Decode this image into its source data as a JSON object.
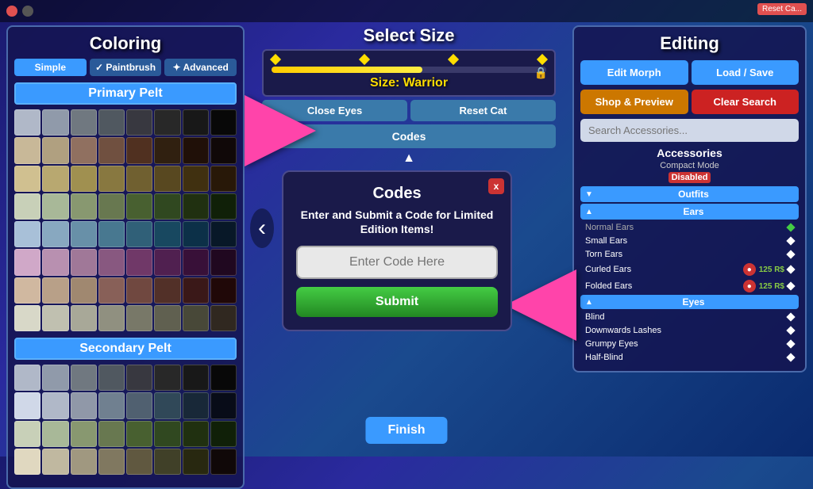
{
  "topbar": {
    "reset_label": "Reset Ca..."
  },
  "left_panel": {
    "title": "Coloring",
    "tabs": [
      {
        "label": "Simple",
        "active": true
      },
      {
        "label": "✓ Paintbrush",
        "active": false
      },
      {
        "label": "✦ Advanced",
        "active": false
      }
    ],
    "primary_label": "Primary Pelt",
    "secondary_label": "Secondary Pelt"
  },
  "center_top": {
    "title": "Select Size",
    "size_label": "Size: Warrior",
    "close_eyes_btn": "Close Eyes",
    "reset_cat_btn": "Reset Cat",
    "codes_btn": "Codes",
    "slider_percent": 55
  },
  "codes_modal": {
    "title": "Codes",
    "subtitle": "Enter and Submit a Code for Limited Edition Items!",
    "input_placeholder": "Enter Code Here",
    "submit_label": "Submit",
    "close_label": "x"
  },
  "right_panel": {
    "title": "Editing",
    "edit_morph_btn": "Edit Morph",
    "load_save_btn": "Load / Save",
    "shop_preview_btn": "Shop & Preview",
    "clear_search_btn": "Clear Search",
    "search_placeholder": "Search Accessories...",
    "accessories_label": "Accessories",
    "compact_mode_label": "Compact Mode",
    "disabled_label": "Disabled",
    "categories": [
      {
        "label": "Outfits",
        "active": true
      },
      {
        "label": "Ears",
        "active": true
      }
    ],
    "ear_items": [
      {
        "label": "Normal Ears",
        "dimmed": true,
        "has_diamond": true,
        "diamond_green": true
      },
      {
        "label": "Small Ears",
        "dimmed": false,
        "has_diamond": true
      },
      {
        "label": "Torn Ears",
        "dimmed": false,
        "has_diamond": true
      },
      {
        "label": "Curled Ears",
        "dimmed": false,
        "has_price": true,
        "price": "125 R$",
        "has_diamond": true
      },
      {
        "label": "Folded Ears",
        "dimmed": false,
        "has_price": true,
        "price": "125 R$",
        "has_diamond": true
      }
    ],
    "eyes_header": "Eyes",
    "eye_items": [
      {
        "label": "Blind",
        "has_diamond": true
      },
      {
        "label": "Downwards Lashes",
        "has_diamond": true
      },
      {
        "label": "Grumpy Eyes",
        "has_diamond": true
      },
      {
        "label": "Half-Blind",
        "has_diamond": true
      }
    ]
  },
  "finish_btn": "Finish",
  "colors": {
    "primary_rows": [
      [
        "#b0b8c8",
        "#909aaa",
        "#707880",
        "#505860",
        "#383840",
        "#282828",
        "#181818",
        "#080808"
      ],
      [
        "#c8b898",
        "#b0a080",
        "#907060",
        "#705040",
        "#503020",
        "#302010",
        "#201008",
        "#100808"
      ],
      [
        "#d0c090",
        "#b8a870",
        "#a09050",
        "#887840",
        "#706030",
        "#584820",
        "#403010",
        "#281808"
      ],
      [
        "#c8d0b8",
        "#a8b898",
        "#889870",
        "#687850",
        "#486030",
        "#304820",
        "#203010",
        "#102008"
      ],
      [
        "#a8c0d8",
        "#88a8c0",
        "#6890a8",
        "#487890",
        "#306078",
        "#184860",
        "#0c3048",
        "#081828"
      ],
      [
        "#d0a8c8",
        "#b890b0",
        "#a07898",
        "#885880",
        "#703868",
        "#502050",
        "#381038",
        "#200820"
      ],
      [
        "#d0b8a0",
        "#b8a088",
        "#a08870",
        "#886058",
        "#704840",
        "#523028",
        "#3a1818",
        "#200808"
      ],
      [
        "#d8d8c8",
        "#c0c0b0",
        "#a8a898",
        "#909080",
        "#787868",
        "#606050",
        "#484838",
        "#302820"
      ]
    ],
    "secondary_rows": [
      [
        "#b0b8c8",
        "#909aaa",
        "#707880",
        "#505860",
        "#383840",
        "#282828",
        "#181818",
        "#080808"
      ],
      [
        "#d0d8e8",
        "#b0b8c8",
        "#9098a8",
        "#708090",
        "#506070",
        "#304858",
        "#182838",
        "#080c18"
      ],
      [
        "#c8d0b8",
        "#a8b898",
        "#889870",
        "#687850",
        "#486030",
        "#304820",
        "#203010",
        "#102008"
      ],
      [
        "#e0d8c0",
        "#c0b8a0",
        "#a09880",
        "#807860",
        "#605840",
        "#404028",
        "#282810",
        "#100808"
      ]
    ]
  }
}
